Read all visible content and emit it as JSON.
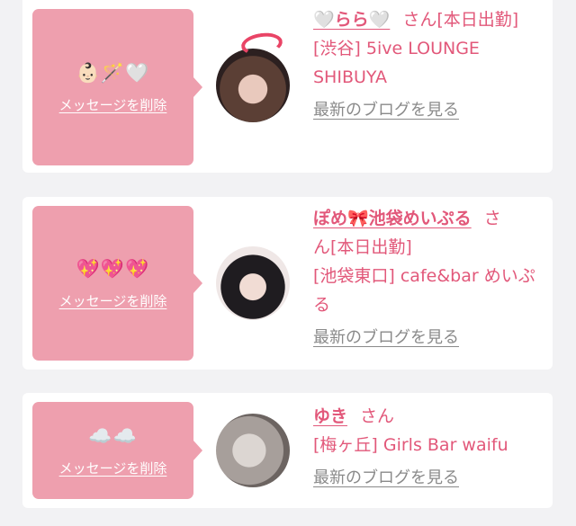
{
  "cards": [
    {
      "emoji": "👶🏻🪄🤍",
      "delete_label": "メッセージを削除",
      "name": "🤍らら🤍",
      "san": "さん",
      "status": "[本日出勤]",
      "shop": "[渋谷] 5ive LOUNGE SHIBUYA",
      "blog_label": "最新のブログを見る"
    },
    {
      "emoji": "💖💖💖",
      "delete_label": "メッセージを削除",
      "name": "ぽめ🎀池袋めいぷる",
      "san": "さ",
      "status": "ん[本日出勤]",
      "shop": "[池袋東口] cafe&bar めいぷる",
      "blog_label": "最新のブログを見る"
    },
    {
      "emoji": "☁️☁️",
      "delete_label": "メッセージを削除",
      "name": "ゆき",
      "san": "さん",
      "status": "",
      "shop": "[梅ヶ丘] Girls Bar waifu",
      "blog_label": "最新のブログを見る"
    }
  ],
  "colors": {
    "accent": "#e2587a",
    "bubble": "#ee9fae",
    "link_gray": "#8a8a8a",
    "background": "#f2f2f4"
  },
  "icons": [
    "avatar-photo",
    "pink-speech-bubble"
  ]
}
